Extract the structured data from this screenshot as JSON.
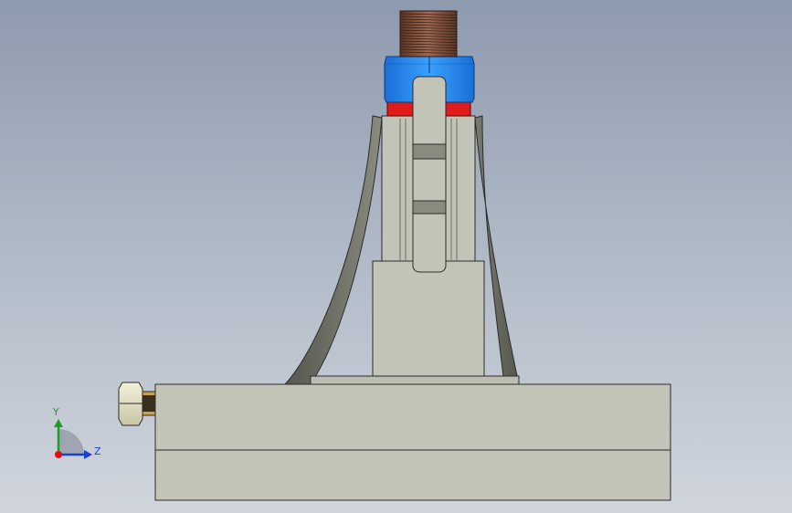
{
  "viewport": {
    "background_top": "#8e9aae",
    "background_bottom": "#d0d5dd"
  },
  "colors": {
    "body_face": "#c3c4b8",
    "body_shadow": "#6c6d62",
    "edge": "#2b2b2b",
    "nut_blue": "#1e7fe8",
    "washer_red": "#e01b1b",
    "thread": "#7a4a35",
    "brass": "#c8a24a",
    "axis_x": "#e01010",
    "axis_y": "#1ea01e",
    "axis_z": "#1a3fd0"
  },
  "triad": {
    "y_label": "Y",
    "z_label": "Z",
    "icon": "coordinate-axes-icon"
  }
}
